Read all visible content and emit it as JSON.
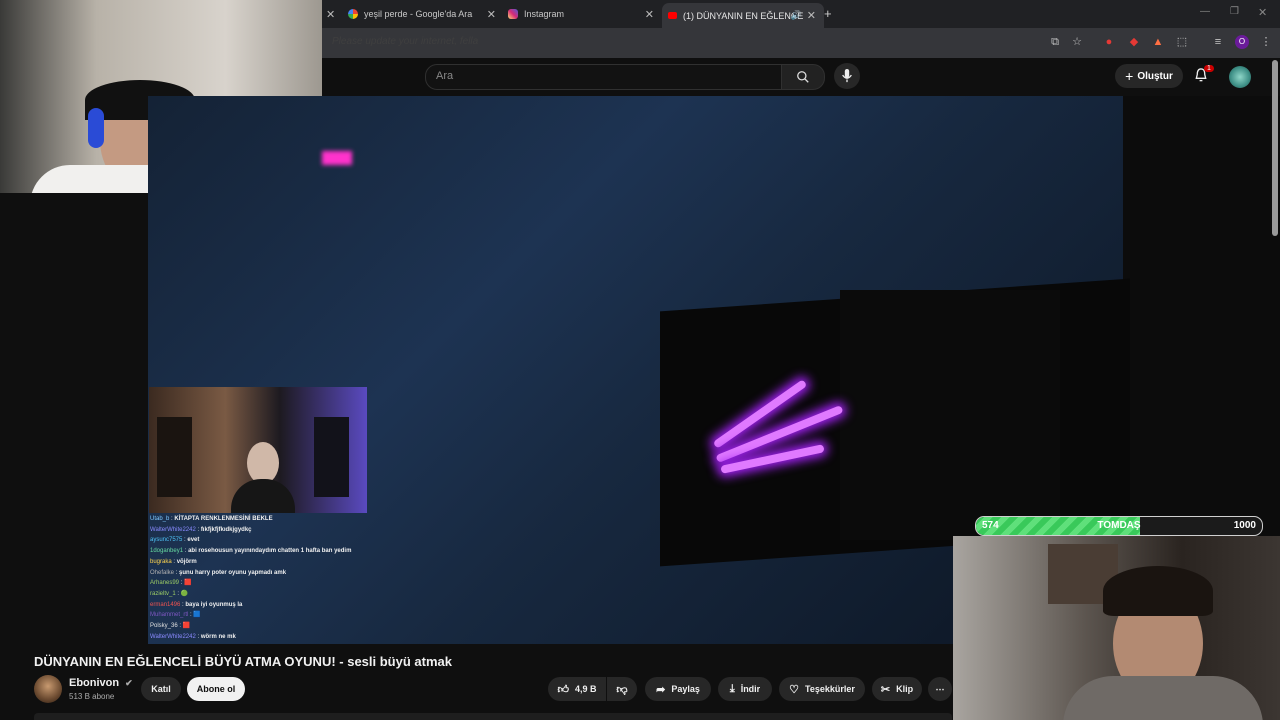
{
  "tabs": [
    {
      "title": "yeşil perde - Google'da Ara"
    },
    {
      "title": "Instagram"
    },
    {
      "title": "(1) DÜNYANIN EN EĞLENCE"
    }
  ],
  "address_placeholder": "Please update your internet, fella",
  "search": {
    "placeholder": "Ara"
  },
  "header": {
    "create_label": "Oluştur",
    "notification_count": "1"
  },
  "chat": [
    {
      "user": "Utab_b",
      "msg": "KİTAPTA RENKLENMESİNİ BEKLE",
      "color": "#7ec8ff"
    },
    {
      "user": "WalterWhite2242",
      "msg": "fıkfjkfjfkıdkjgydkç",
      "color": "#8a8aff"
    },
    {
      "user": "aysunc7575",
      "msg": "evet",
      "color": "#4fc3f7"
    },
    {
      "user": "1doganbey1",
      "msg": "abi rosehousun yayınındaydım chatten 1 hafta ban yedim",
      "color": "#66d9a0"
    },
    {
      "user": "bugraka",
      "msg": "võjörm",
      "color": "#ffd54f"
    },
    {
      "user": "Ohefalke",
      "msg": "şunu harry poter oyunu yapmadı amk",
      "color": "#b0b0b0"
    },
    {
      "user": "Arhanes99",
      "msg": "🟥",
      "color": "#9ccc65"
    },
    {
      "user": "razieltv_1",
      "msg": "🟢",
      "color": "#9ccc65"
    },
    {
      "user": "erman1496",
      "msg": "baya iyi oyunmuş la",
      "color": "#ef5350"
    },
    {
      "user": "Muhammet_rtl",
      "msg": "🟦",
      "color": "#7e57c2"
    },
    {
      "user": "Polsky_36",
      "msg": "🟥",
      "color": "#e0e0e0"
    },
    {
      "user": "WalterWhite2242",
      "msg": "wörm ne mk",
      "color": "#8a8aff"
    }
  ],
  "progress": {
    "left_label": "574",
    "center_label": "TOMDAŞ",
    "right_label": "1000",
    "value": 574,
    "max": 1000
  },
  "video": {
    "title": "DÜNYANIN EN EĞLENCELİ BÜYÜ ATMA OYUNU! - sesli büyü atmak"
  },
  "channel": {
    "name": "Ebonivon",
    "subscribers": "513 B abone"
  },
  "buttons": {
    "join": "Katıl",
    "subscribe": "Abone ol",
    "likes": "4,9 B",
    "share": "Paylaş",
    "download": "İndir",
    "thanks": "Teşekkürler",
    "clip": "Klip",
    "more": "⋯"
  },
  "icons": {
    "verified": "verified-icon",
    "like": "thumbs-up-icon",
    "dislike": "thumbs-down-icon"
  }
}
